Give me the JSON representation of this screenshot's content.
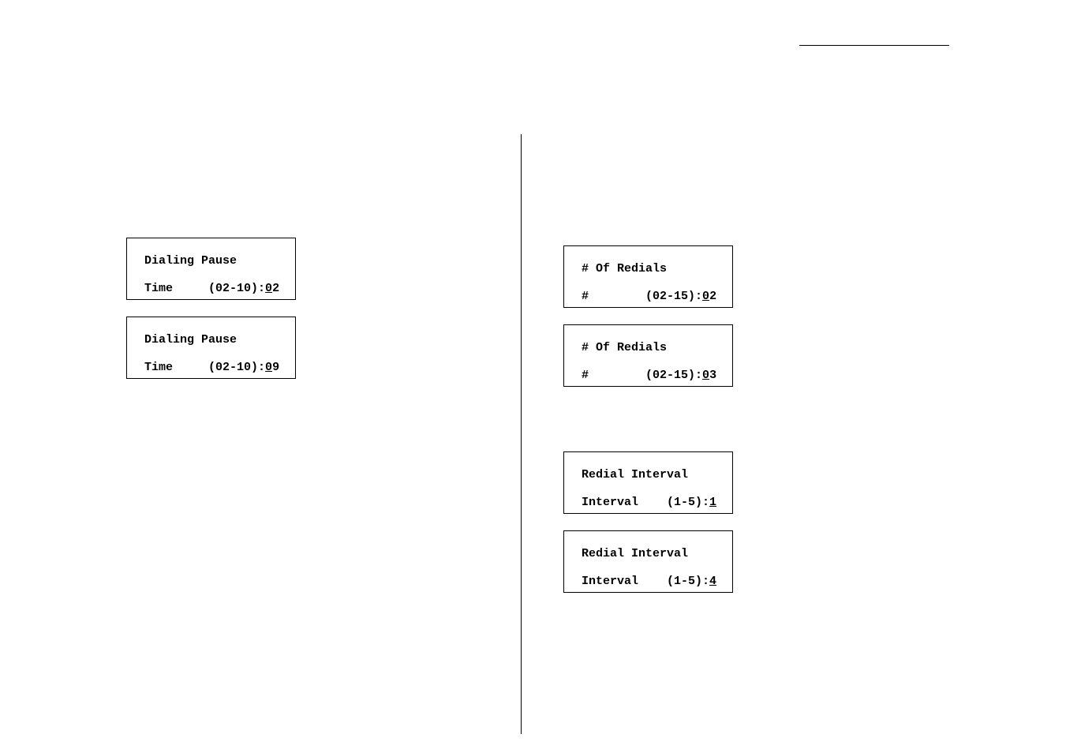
{
  "left": {
    "box1": {
      "line1": "Dialing Pause",
      "line2_prefix": "Time     (02-10):",
      "line2_u": "0",
      "line2_suffix": "2"
    },
    "box2": {
      "line1": "Dialing Pause",
      "line2_prefix": "Time     (02-10):",
      "line2_u": "0",
      "line2_suffix": "9"
    }
  },
  "right": {
    "box1": {
      "line1": "# Of Redials",
      "line2_prefix": "#        (02-15):",
      "line2_u": "0",
      "line2_suffix": "2"
    },
    "box2": {
      "line1": "# Of Redials",
      "line2_prefix": "#        (02-15):",
      "line2_u": "0",
      "line2_suffix": "3"
    },
    "box3": {
      "line1": "Redial Interval",
      "line2_prefix": "Interval    (1-5):",
      "line2_u": "1",
      "line2_suffix": ""
    },
    "box4": {
      "line1": "Redial Interval",
      "line2_prefix": "Interval    (1-5):",
      "line2_u": "4",
      "line2_suffix": ""
    }
  }
}
